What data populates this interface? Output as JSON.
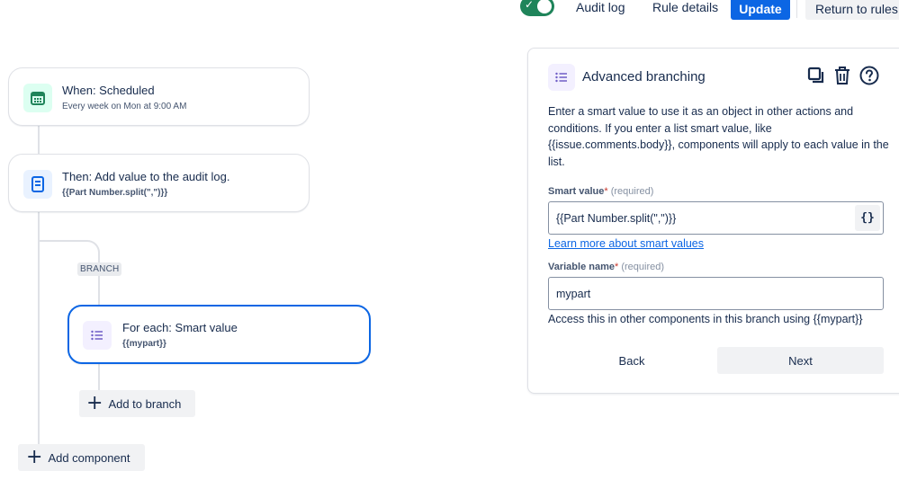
{
  "topbar": {
    "toggle_state": "enabled",
    "audit_log": "Audit log",
    "rule_details": "Rule details",
    "update": "Update",
    "return_to_rules": "Return to rules"
  },
  "flow": {
    "trigger": {
      "title": "When: Scheduled",
      "subtitle": "Every week on Mon at 9:00 AM",
      "icon": "calendar-icon"
    },
    "action": {
      "title": "Then: Add value to the audit log.",
      "subtitle": "{{Part Number.split(\",\")}}",
      "icon": "document-icon"
    },
    "branch_label": "BRANCH",
    "branch": {
      "title": "For each: Smart value",
      "subtitle": "{{mypart}}",
      "icon": "list-icon"
    },
    "add_to_branch": "Add to branch",
    "add_component": "Add component"
  },
  "panel": {
    "title": "Advanced branching",
    "description": "Enter a smart value to use it as an object in other actions and conditions. If you enter a list smart value, like {{issue.comments.body}}, components will apply to each value in the list.",
    "smart_value_label": "Smart value",
    "smart_value_required": "(required)",
    "smart_value": "{{Part Number.split(\",\")}}",
    "smart_value_button": "{}",
    "learn_more": "Learn more about smart values",
    "variable_label": "Variable name",
    "variable_required": "(required)",
    "variable_value": "mypart",
    "variable_helper": "Access this in other components in this branch using {{mypart}}",
    "back": "Back",
    "next": "Next"
  },
  "colors": {
    "primary": "#0c66e4",
    "toggle": "#1f845a",
    "trigger_icon_bg": "#dcfff1",
    "action_icon_bg": "#e9f2ff",
    "branch_icon_bg": "#f3f0ff"
  }
}
